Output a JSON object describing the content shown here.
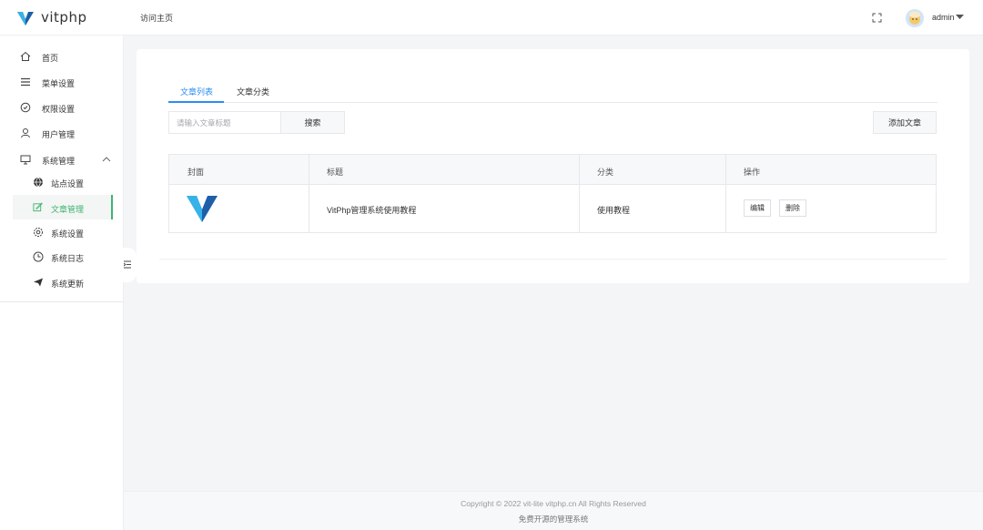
{
  "header": {
    "brand": "vitphp",
    "home_link": "访问主页",
    "username": "admin"
  },
  "sidebar": {
    "items": [
      {
        "label": "首页",
        "icon": "home-icon"
      },
      {
        "label": "菜单设置",
        "icon": "list-icon"
      },
      {
        "label": "权限设置",
        "icon": "shield-icon"
      },
      {
        "label": "用户管理",
        "icon": "user-icon"
      },
      {
        "label": "系统管理",
        "icon": "monitor-icon"
      }
    ],
    "sub_items": [
      {
        "label": "站点设置",
        "icon": "globe-icon"
      },
      {
        "label": "文章管理",
        "icon": "edit-icon"
      },
      {
        "label": "系统设置",
        "icon": "gear-icon"
      },
      {
        "label": "系统日志",
        "icon": "clock-icon"
      },
      {
        "label": "系统更新",
        "icon": "send-icon"
      }
    ]
  },
  "tabs": {
    "list": "文章列表",
    "category": "文章分类"
  },
  "search": {
    "placeholder": "请输入文章标题",
    "button": "搜索"
  },
  "add_button": "添加文章",
  "table": {
    "headers": [
      "封面",
      "标题",
      "分类",
      "操作"
    ],
    "rows": [
      {
        "title": "VitPhp管理系统使用教程",
        "category": "使用教程",
        "edit": "编辑",
        "delete": "删除"
      }
    ]
  },
  "footer": {
    "copyright": "Copyright © 2022 vit-lite vitphp.cn All Rights Reserved",
    "tagline": "免费开源的管理系统"
  },
  "colors": {
    "accent_active": "#3fb371",
    "tab_active": "#2d8cf0",
    "logo_dark": "#1d5fa8",
    "logo_light": "#35b3e8"
  }
}
